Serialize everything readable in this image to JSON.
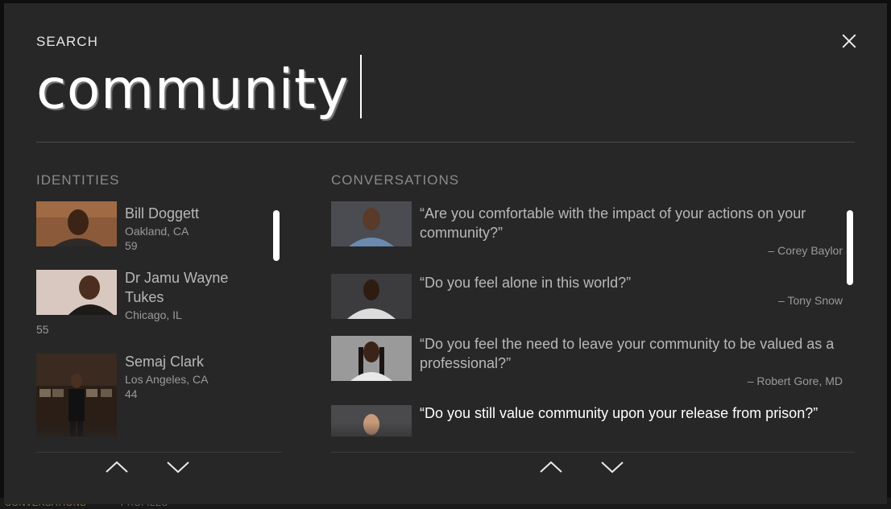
{
  "search": {
    "label": "SEARCH",
    "query": "community"
  },
  "background": {
    "bottom_left_label": "CONVERSATIONS",
    "bottom_label_2": "PROFILES"
  },
  "identities": {
    "title": "IDENTITIES",
    "items": [
      {
        "name": "Bill Doggett",
        "location": "Oakland, CA",
        "age": "59"
      },
      {
        "name": "Dr Jamu Wayne Tukes",
        "location": "Chicago, IL",
        "age": "55"
      },
      {
        "name": "Semaj Clark",
        "location": "Los Angeles, CA",
        "age": "44"
      }
    ]
  },
  "conversations": {
    "title": "CONVERSATIONS",
    "items": [
      {
        "quote": "“Are you comfortable with the impact of your actions on your community?”",
        "author": "– Corey Baylor"
      },
      {
        "quote": "“Do you feel alone in this world?”",
        "author": "– Tony Snow"
      },
      {
        "quote": "“Do you feel the need to leave your community to be valued as a professional?”",
        "author": "– Robert Gore, MD"
      },
      {
        "quote": "“Do you still value community upon your release from prison?”",
        "author": ""
      }
    ]
  },
  "icons": {
    "close": "close-icon",
    "up": "chevron-up-icon",
    "down": "chevron-down-icon"
  },
  "colors": {
    "modal_bg": "#272727",
    "text_primary": "#ffffff",
    "text_muted": "#9a9a9a",
    "accent_bottom": "#8a7a3a"
  }
}
